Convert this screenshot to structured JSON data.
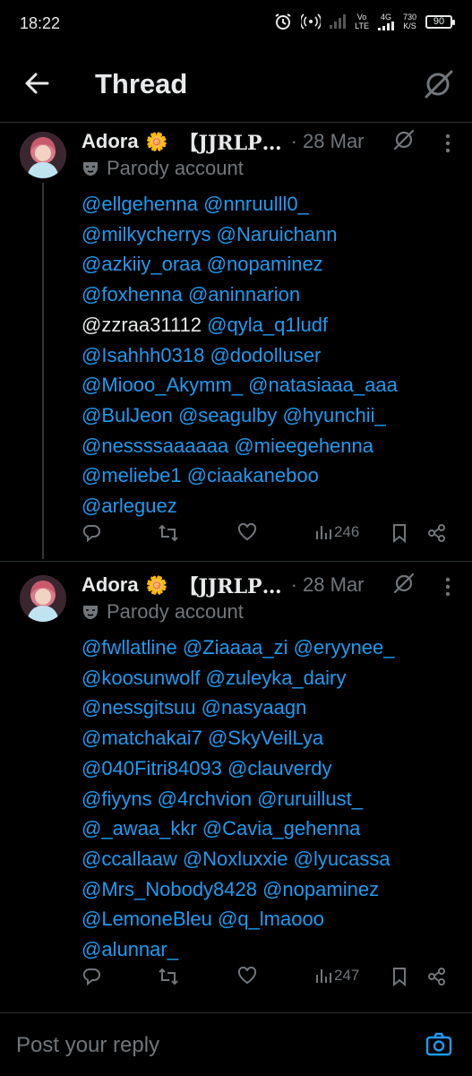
{
  "status_bar": {
    "time": "18:22",
    "net_top": "Vo",
    "net_bottom": "LTE",
    "gen_top": "4G",
    "speed_top": "730",
    "speed_bottom": "K/S",
    "battery": "90"
  },
  "header": {
    "title": "Thread"
  },
  "tweets": [
    {
      "name": "Adora",
      "flower": "🌼",
      "bracket": "【JJRLP…",
      "date": "· 28 Mar",
      "parody": "Parody account",
      "lines": [
        "@ellgehenna @nnruulll0_",
        "@milkycherrys @Naruichann",
        "@azkiiy_oraa @nopaminez",
        "@foxhenna @aninnarion",
        "@qyla_q1ludf",
        "@Isahhh0318 @dodolluser",
        "@Miooo_Akymm_ @natasiaaa_aaa",
        "@BulJeon @seagulby @hyunchii_",
        "@nessssaaaaaa @mieegehenna",
        "@meliebe1 @ciaakaneboo",
        "@arleguez"
      ],
      "plain_prefix": "@zzraa31112",
      "views": "246"
    },
    {
      "name": "Adora",
      "flower": "🌼",
      "bracket": "【JJRLP…",
      "date": "· 28 Mar",
      "parody": "Parody account",
      "lines": [
        "@fwllatline @Ziaaaa_zi @eryynee_",
        "@koosunwolf @zuleyka_dairy",
        "@nessgitsuu @nasyaagn",
        "@matchakai7 @SkyVeilLya",
        "@040Fitri84093 @clauverdy",
        "@fiyyns @4rchvion @ruruillust_",
        "@_awaa_kkr @Cavia_gehenna",
        "@ccallaaw @Noxluxxie @lyucassa",
        "@Mrs_Nobody8428 @nopaminez",
        "@LemoneBleu @q_lmaooo",
        "@alunnar_"
      ],
      "views": "247"
    }
  ],
  "reply": {
    "placeholder": "Post your reply"
  },
  "icons": {
    "back": "arrow-left-icon",
    "grok": "grok-icon",
    "more": "more-vertical-icon",
    "parody": "mask-icon",
    "reply": "comment-icon",
    "retweet": "retweet-icon",
    "like": "heart-icon",
    "views": "views-icon",
    "bookmark": "bookmark-icon",
    "share": "share-icon",
    "camera": "camera-icon"
  },
  "colors": {
    "accent": "#1d9bf0",
    "muted": "#71767b",
    "text": "#e7e9ea",
    "bg": "#000000"
  }
}
